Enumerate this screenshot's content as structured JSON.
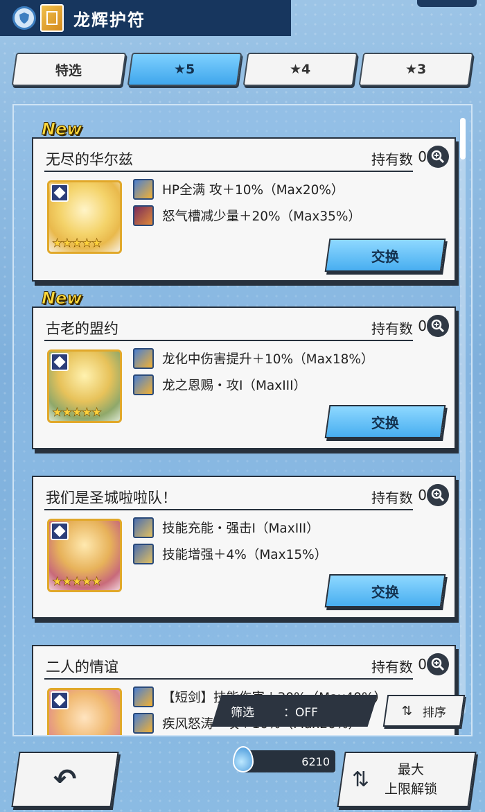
{
  "header": {
    "title": "龙辉护符"
  },
  "tabs": [
    {
      "label": "特选",
      "active": false
    },
    {
      "label": "★5",
      "active": true
    },
    {
      "label": "★4",
      "active": false
    },
    {
      "label": "★3",
      "active": false
    }
  ],
  "cards": [
    {
      "new": "New",
      "title": "无尽的华尔兹",
      "hold_label": "持有数",
      "hold_count": "0",
      "stars": "★★★★★",
      "effects": [
        "HP全满 攻＋10%（Max20%）",
        "怒气槽减少量＋20%（Max35%）"
      ],
      "exchange": "交换"
    },
    {
      "new": "New",
      "title": "古老的盟约",
      "hold_label": "持有数",
      "hold_count": "0",
      "stars": "★★★★★",
      "effects": [
        "龙化中伤害提升＋10%（Max18%）",
        "龙之恩赐・攻I（MaxIII）"
      ],
      "exchange": "交换"
    },
    {
      "new": "",
      "title": "我们是圣城啦啦队！",
      "hold_label": "持有数",
      "hold_count": "0",
      "stars": "★★★★★",
      "effects": [
        "技能充能・强击I（MaxIII）",
        "技能增强＋4%（Max15%）"
      ],
      "exchange": "交换"
    },
    {
      "new": "",
      "title": "二人的情谊",
      "hold_label": "持有数",
      "hold_count": "0",
      "stars": "★★★★★",
      "effects": [
        "【短剑】技能伤害＋30%（Max40%）",
        "疾风怒涛・攻＋10%（Max20%）"
      ],
      "exchange": ""
    }
  ],
  "filter": {
    "label": "筛选",
    "value": "：OFF"
  },
  "sort": {
    "label": "排序",
    "icon": "sort-icon"
  },
  "currency": {
    "value": "6210",
    "icon": "water-drop-icon"
  },
  "back": {
    "icon": "back-arrow-icon"
  },
  "unlock": {
    "line1": "最大",
    "line2": "上限解锁",
    "icon": "refresh-icon"
  },
  "colors": {
    "accent": "#48aef0",
    "header_bg": "#17365e",
    "card_border": "#27313d"
  }
}
